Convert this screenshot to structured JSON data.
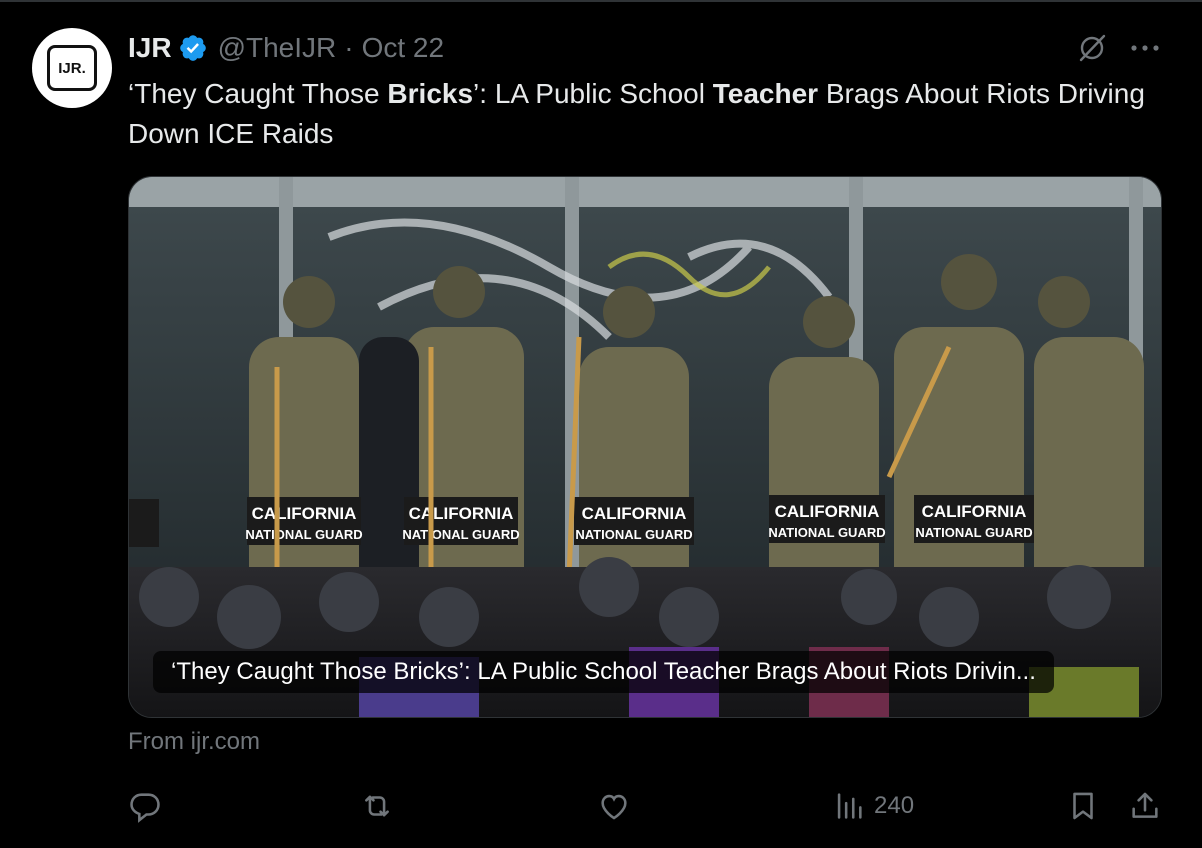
{
  "tweet": {
    "author_name": "IJR",
    "avatar_text": "IJR.",
    "handle": "@TheIJR",
    "separator": "·",
    "date": "Oct 22",
    "text_parts": [
      {
        "text": "‘They Caught Those ",
        "bold": false
      },
      {
        "text": "Bricks",
        "bold": true
      },
      {
        "text": "’: LA Public School ",
        "bold": false
      },
      {
        "text": "Teacher",
        "bold": true
      },
      {
        "text": " Brags About Riots Driving Down ICE Raids",
        "bold": false
      }
    ]
  },
  "card": {
    "title": "‘They Caught Those Bricks’: LA Public School Teacher Brags About Riots Drivin...",
    "shield_text_1": "CALIFORNIA",
    "shield_text_2": "NATIONAL GUARD",
    "source": "From ijr.com"
  },
  "actions": {
    "reply_count": "",
    "retweet_count": "",
    "like_count": "",
    "views_count": "240"
  },
  "icons": [
    "verified-badge-icon",
    "grok-icon",
    "more-icon",
    "reply-icon",
    "retweet-icon",
    "like-icon",
    "views-icon",
    "bookmark-icon",
    "share-icon"
  ],
  "colors": {
    "background": "#000000",
    "text": "#e7e9ea",
    "muted": "#71767b",
    "verified": "#1d9bf0"
  }
}
